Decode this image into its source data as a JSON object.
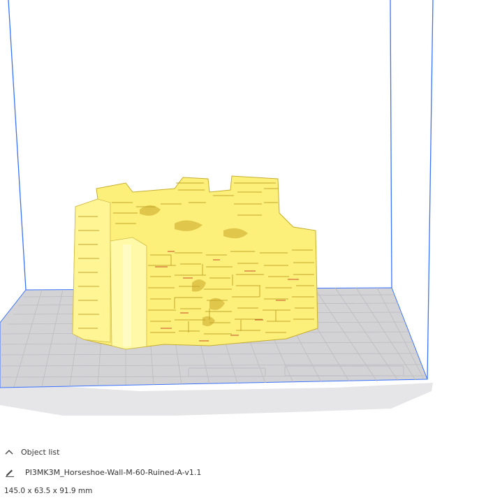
{
  "viewport": {
    "scene": "3d-build-volume-with-model",
    "colors": {
      "volume_edge": "#3a72ff",
      "bed_fill": "#d2d2d4",
      "bed_grid": "#b9b9bd",
      "model_fill": "#fdf07a",
      "model_shadow": "#d9c33a",
      "model_accent": "#c84a2a"
    }
  },
  "object_panel": {
    "header_label": "Object list",
    "header_icon": "chevron-up-icon",
    "edit_icon": "pencil-icon",
    "object_name": "PI3MK3M_Horseshoe-Wall-M-60-Ruined-A-v1.1",
    "dimensions": "145.0 x 63.5 x 91.9 mm"
  }
}
